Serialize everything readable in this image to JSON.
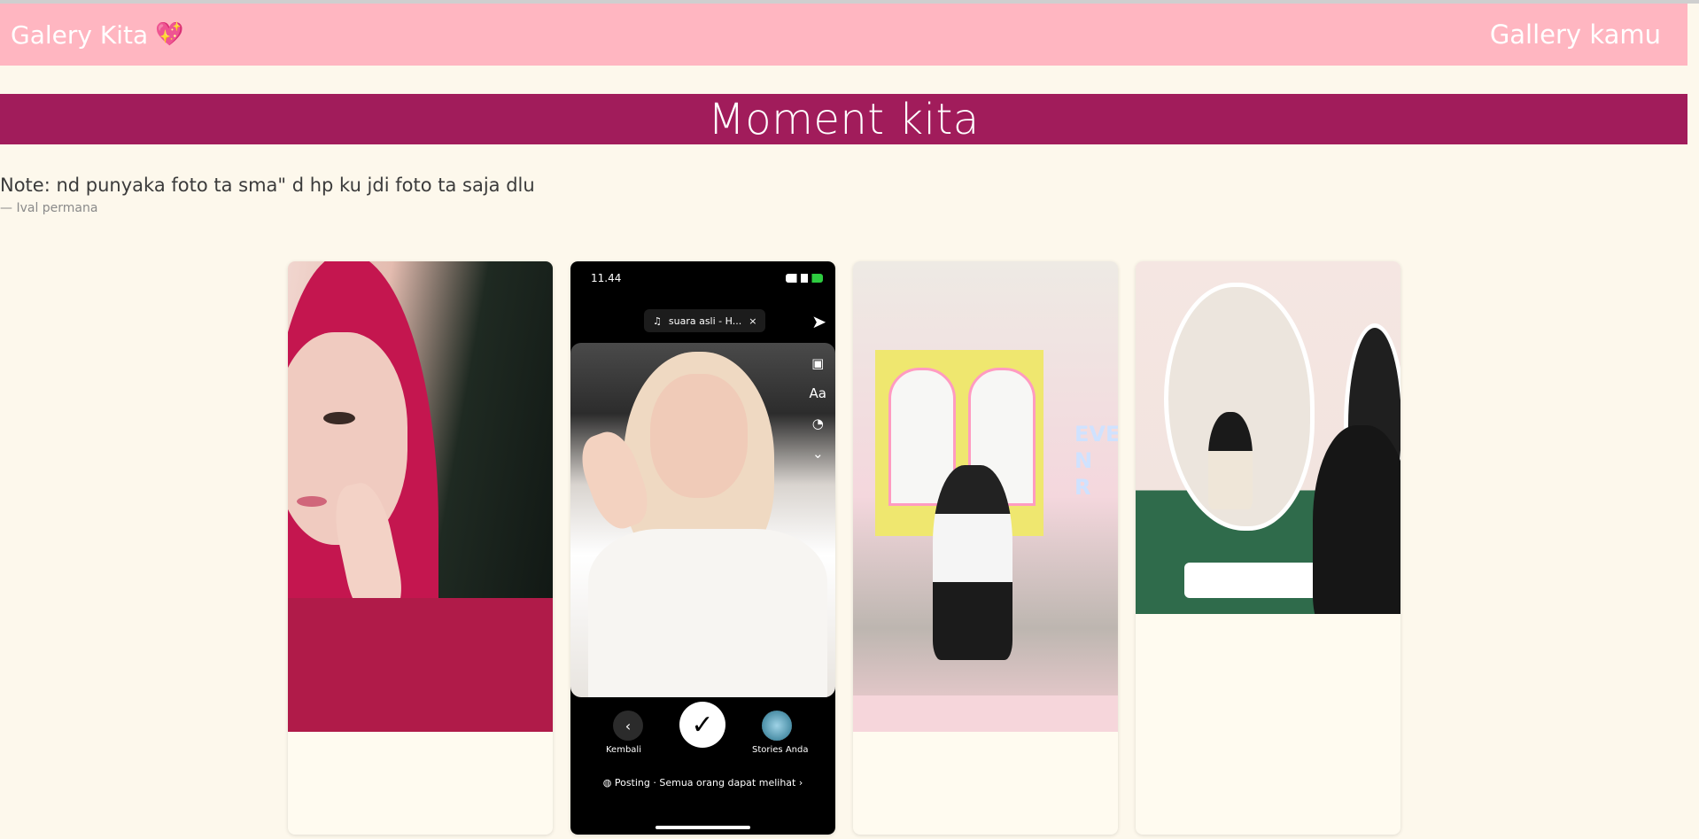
{
  "navbar": {
    "brand": "Galery Kita",
    "brand_emoji": "💖",
    "link": "Gallery kamu"
  },
  "banner": {
    "title": "Moment kita"
  },
  "note": {
    "text": "Note: nd punyaka foto ta sma\" d hp ku jdi foto ta saja dlu",
    "author": "— Ival permana"
  },
  "phone": {
    "time": "11.44",
    "music": "suara asli - H...",
    "music_close": "×",
    "side_tools": [
      "Aa"
    ],
    "back_label": "Kembali",
    "stories_label": "Stories Anda",
    "posting": "Posting · Semua orang dapat melihat"
  },
  "photo3": {
    "neon_text": "EVE\nN\nR"
  },
  "colors": {
    "navbar": "#ffb6c1",
    "banner": "#a11c5b",
    "background": "#fdf8ec"
  }
}
